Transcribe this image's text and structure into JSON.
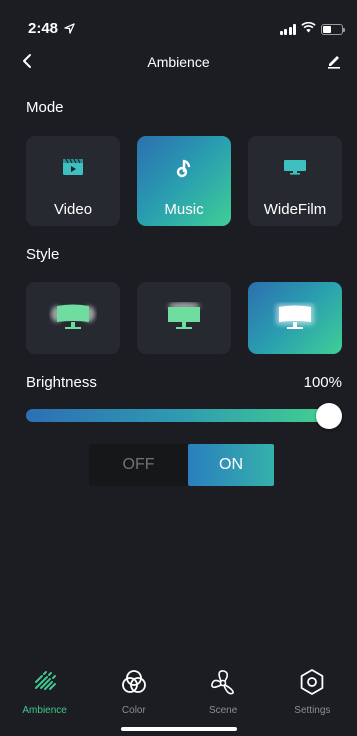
{
  "status_bar": {
    "time": "2:48"
  },
  "nav": {
    "title": "Ambience",
    "back_icon": "chevron-left-icon",
    "edit_icon": "edit-pencil-icon"
  },
  "mode": {
    "label": "Mode",
    "options": [
      {
        "label": "Video",
        "icon": "video-icon",
        "active": false
      },
      {
        "label": "Music",
        "icon": "music-note-icon",
        "active": true
      },
      {
        "label": "WideFilm",
        "icon": "widescreen-monitor-icon",
        "active": false
      }
    ]
  },
  "style": {
    "label": "Style",
    "options": [
      {
        "icon": "monitor-glow-sides-icon",
        "active": false
      },
      {
        "icon": "monitor-glow-top-icon",
        "active": false
      },
      {
        "icon": "monitor-glow-full-icon",
        "active": true
      }
    ]
  },
  "brightness": {
    "label": "Brightness",
    "value_text": "100%",
    "value": 100
  },
  "power_toggle": {
    "off_label": "OFF",
    "on_label": "ON",
    "selected": "ON"
  },
  "tabs": [
    {
      "label": "Ambience",
      "icon": "ambience-rays-icon",
      "active": true
    },
    {
      "label": "Color",
      "icon": "color-circles-icon",
      "active": false
    },
    {
      "label": "Scene",
      "icon": "scene-fan-icon",
      "active": false
    },
    {
      "label": "Settings",
      "icon": "settings-hexagon-icon",
      "active": false
    }
  ],
  "colors": {
    "accent_green": "#3fc98e",
    "accent_blue": "#2c6fb0",
    "background": "#1b1d22",
    "tile": "#262a30"
  }
}
